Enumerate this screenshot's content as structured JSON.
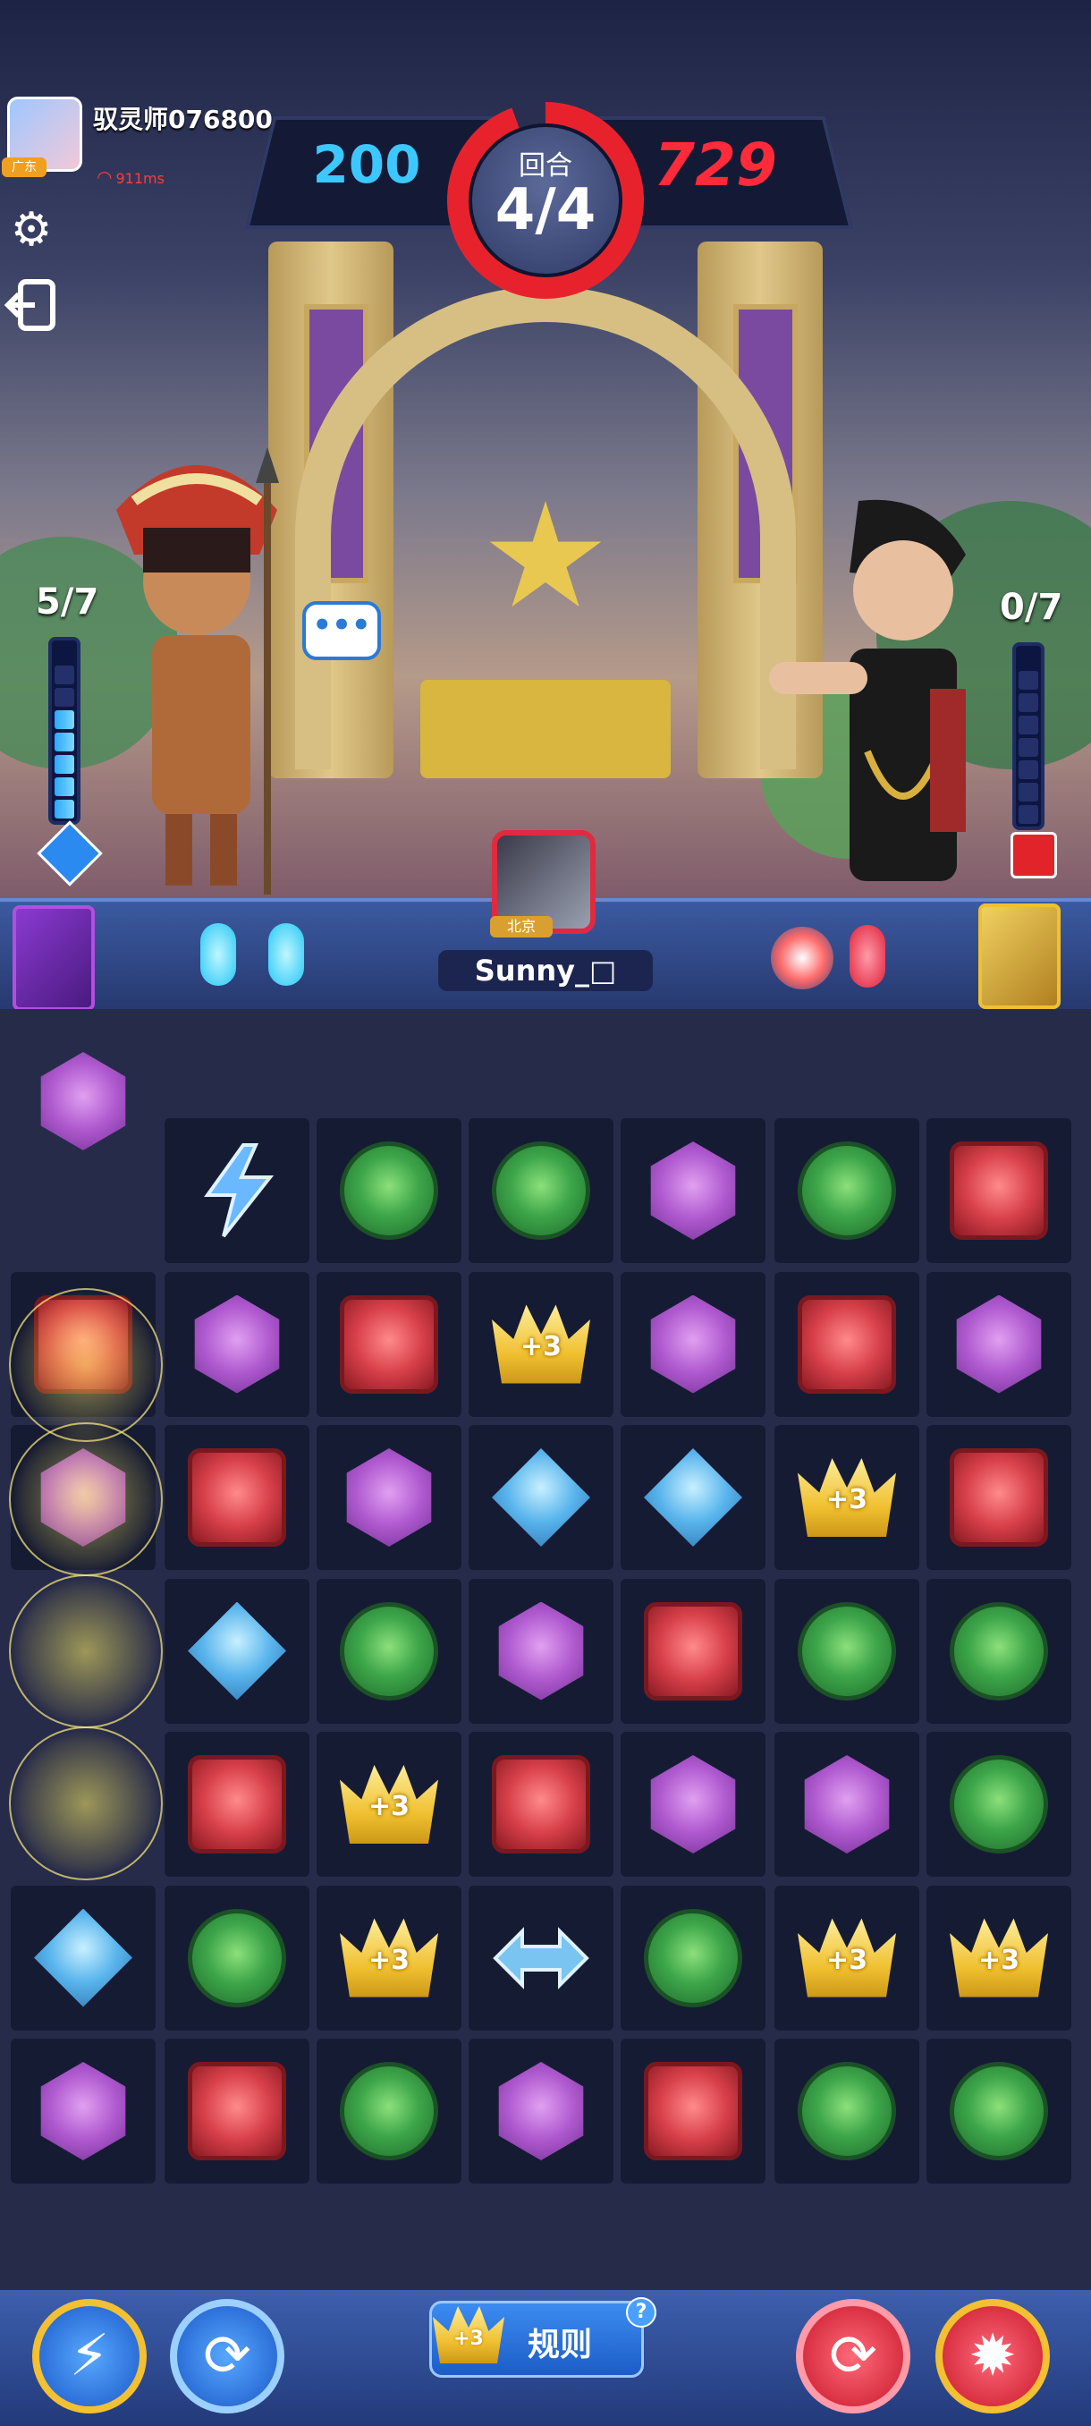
{
  "player": {
    "name": "驭灵师076800",
    "region": "广东",
    "ping": "911ms",
    "score": "200",
    "energy": "5/7",
    "energy_filled": 5,
    "energy_max": 7
  },
  "opponent": {
    "name": "Sunny_□",
    "region": "北京",
    "score": "729",
    "energy": "0/7",
    "energy_filled": 0,
    "energy_max": 7
  },
  "round": {
    "label": "回合",
    "value": "4/4"
  },
  "speech_bubble": "•••",
  "toolbar": {
    "settings_icon": "gear-icon",
    "exit_icon": "exit-icon"
  },
  "board": {
    "columns": 7,
    "rows": [
      [
        "purple",
        "",
        "",
        "",
        "",
        "",
        ""
      ],
      [
        "",
        "lightning",
        "green",
        "green",
        "purple",
        "green",
        "red"
      ],
      [
        "red",
        "purple",
        "red",
        "crown",
        "purple",
        "red",
        "purple"
      ],
      [
        "purple",
        "red",
        "purple",
        "blue",
        "blue",
        "crown",
        "red"
      ],
      [
        "",
        "blue",
        "green",
        "purple",
        "red",
        "green",
        "green"
      ],
      [
        "",
        "red",
        "crown",
        "red",
        "purple",
        "purple",
        "green"
      ],
      [
        "blue",
        "green",
        "crown",
        "swap",
        "green",
        "crown",
        "crown"
      ],
      [
        "purple",
        "red",
        "green",
        "purple",
        "red",
        "green",
        "green"
      ]
    ],
    "crown_text": "+3"
  },
  "bottom": {
    "rules_label": "规则",
    "rules_badge": "?",
    "crown_text": "+3",
    "left_buttons": [
      "lightning-skill",
      "refresh-skill"
    ],
    "right_buttons": [
      "refresh-skill",
      "burst-skill"
    ]
  }
}
